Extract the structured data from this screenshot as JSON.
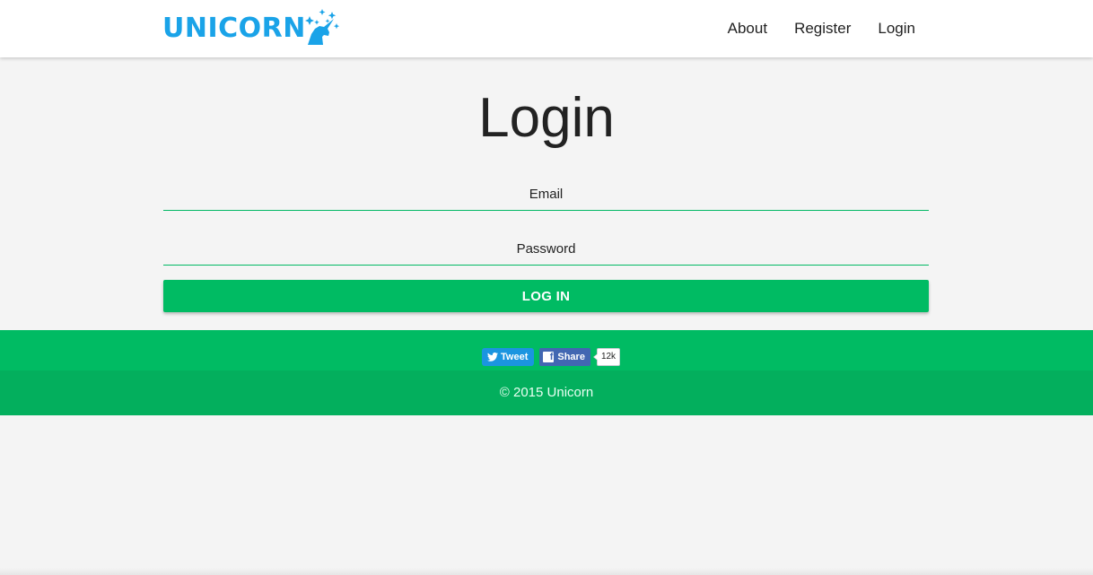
{
  "brand": {
    "name": "UNICORN",
    "color": "#1aa3e8"
  },
  "nav": {
    "about": "About",
    "register": "Register",
    "login": "Login"
  },
  "page": {
    "title": "Login"
  },
  "form": {
    "email_placeholder": "Email",
    "email_value": "",
    "password_placeholder": "Password",
    "password_value": "",
    "submit_label": "LOG IN"
  },
  "social": {
    "tweet_label": "Tweet",
    "share_label": "Share",
    "share_count": "12k"
  },
  "footer": {
    "copyright": "© 2015 Unicorn"
  },
  "colors": {
    "accent": "#00bb63",
    "footer_dark": "#03af5d",
    "twitter": "#1b95e0",
    "facebook": "#4267b2"
  },
  "icons": [
    "unicorn-logo-icon",
    "twitter-bird-icon",
    "facebook-icon"
  ]
}
